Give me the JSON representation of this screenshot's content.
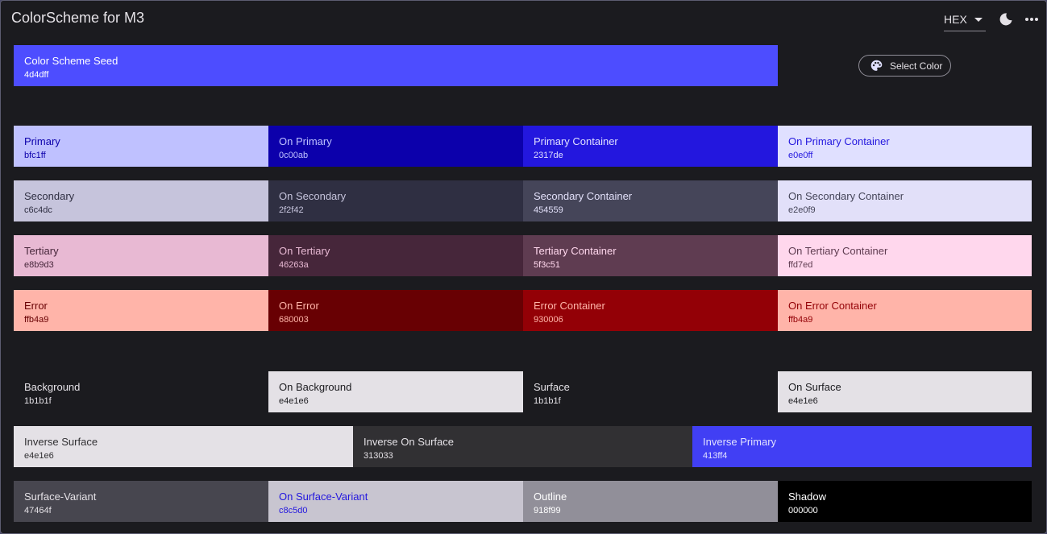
{
  "app": {
    "title": "ColorScheme for M3",
    "format_value": "HEX"
  },
  "seed": {
    "name": "Color Scheme Seed",
    "hex": "4d4dff",
    "bg": "#4d4dff",
    "fg": "#ffffff",
    "select_label": "Select Color"
  },
  "roles": {
    "primary": {
      "name": "Primary",
      "hex": "bfc1ff",
      "bg": "#bfc1ff",
      "fg": "#0c00ab"
    },
    "on_primary": {
      "name": "On Primary",
      "hex": "0c00ab",
      "bg": "#0c00ab",
      "fg": "#bfc1ff"
    },
    "primary_container": {
      "name": "Primary Container",
      "hex": "2317de",
      "bg": "#2317de",
      "fg": "#e0e0ff"
    },
    "on_primary_container": {
      "name": "On Primary Container",
      "hex": "e0e0ff",
      "bg": "#e0e0ff",
      "fg": "#2317de"
    },
    "secondary": {
      "name": "Secondary",
      "hex": "c6c4dc",
      "bg": "#c6c4dc",
      "fg": "#2f2f42"
    },
    "on_secondary": {
      "name": "On Secondary",
      "hex": "2f2f42",
      "bg": "#2f2f42",
      "fg": "#c6c4dc"
    },
    "secondary_container": {
      "name": "Secondary Container",
      "hex": "454559",
      "bg": "#454559",
      "fg": "#e2e0f9"
    },
    "on_secondary_container": {
      "name": "On Secondary Container",
      "hex": "e2e0f9",
      "bg": "#e2e0f9",
      "fg": "#454559"
    },
    "tertiary": {
      "name": "Tertiary",
      "hex": "e8b9d3",
      "bg": "#e8b9d3",
      "fg": "#46263a"
    },
    "on_tertiary": {
      "name": "On Tertiary",
      "hex": "46263a",
      "bg": "#46263a",
      "fg": "#e8b9d3"
    },
    "tertiary_container": {
      "name": "Tertiary Container",
      "hex": "5f3c51",
      "bg": "#5f3c51",
      "fg": "#ffd7ed"
    },
    "on_tertiary_container": {
      "name": "On Tertiary Container",
      "hex": "ffd7ed",
      "bg": "#ffd7ed",
      "fg": "#5f3c51"
    },
    "error": {
      "name": "Error",
      "hex": "ffb4a9",
      "bg": "#ffb4a9",
      "fg": "#680003"
    },
    "on_error": {
      "name": "On Error",
      "hex": "680003",
      "bg": "#680003",
      "fg": "#ffb4a9"
    },
    "error_container": {
      "name": "Error Container",
      "hex": "930006",
      "bg": "#930006",
      "fg": "#ffb4a9"
    },
    "on_error_container": {
      "name": "On Error Container",
      "hex": "ffb4a9",
      "bg": "#ffb4a9",
      "fg": "#930006"
    },
    "background": {
      "name": "Background",
      "hex": "1b1b1f",
      "bg": "#1b1b1f",
      "fg": "#e4e1e6"
    },
    "on_background": {
      "name": "On Background",
      "hex": "e4e1e6",
      "bg": "#e4e1e6",
      "fg": "#1b1b1f"
    },
    "surface": {
      "name": "Surface",
      "hex": "1b1b1f",
      "bg": "#1b1b1f",
      "fg": "#e4e1e6"
    },
    "on_surface": {
      "name": "On Surface",
      "hex": "e4e1e6",
      "bg": "#e4e1e6",
      "fg": "#1b1b1f"
    },
    "inverse_surface": {
      "name": "Inverse Surface",
      "hex": "e4e1e6",
      "bg": "#e4e1e6",
      "fg": "#313033"
    },
    "inverse_on_surface": {
      "name": "Inverse On Surface",
      "hex": "313033",
      "bg": "#313033",
      "fg": "#e4e1e6"
    },
    "inverse_primary": {
      "name": "Inverse Primary",
      "hex": "413ff4",
      "bg": "#413ff4",
      "fg": "#e0e0ff"
    },
    "surface_variant": {
      "name": "Surface-Variant",
      "hex": "47464f",
      "bg": "#47464f",
      "fg": "#e4e1e6"
    },
    "on_surface_variant": {
      "name": "On Surface-Variant",
      "hex": "c8c5d0",
      "bg": "#c8c5d0",
      "fg": "#2317de"
    },
    "outline": {
      "name": "Outline",
      "hex": "918f99",
      "bg": "#918f99",
      "fg": "#ffffff"
    },
    "shadow": {
      "name": "Shadow",
      "hex": "000000",
      "bg": "#000000",
      "fg": "#ffffff"
    }
  },
  "icons": {
    "dropdown": "chevron-down-icon",
    "theme": "dark-mode-moon-icon",
    "more": "more-horizontal-icon",
    "palette": "palette-icon"
  }
}
